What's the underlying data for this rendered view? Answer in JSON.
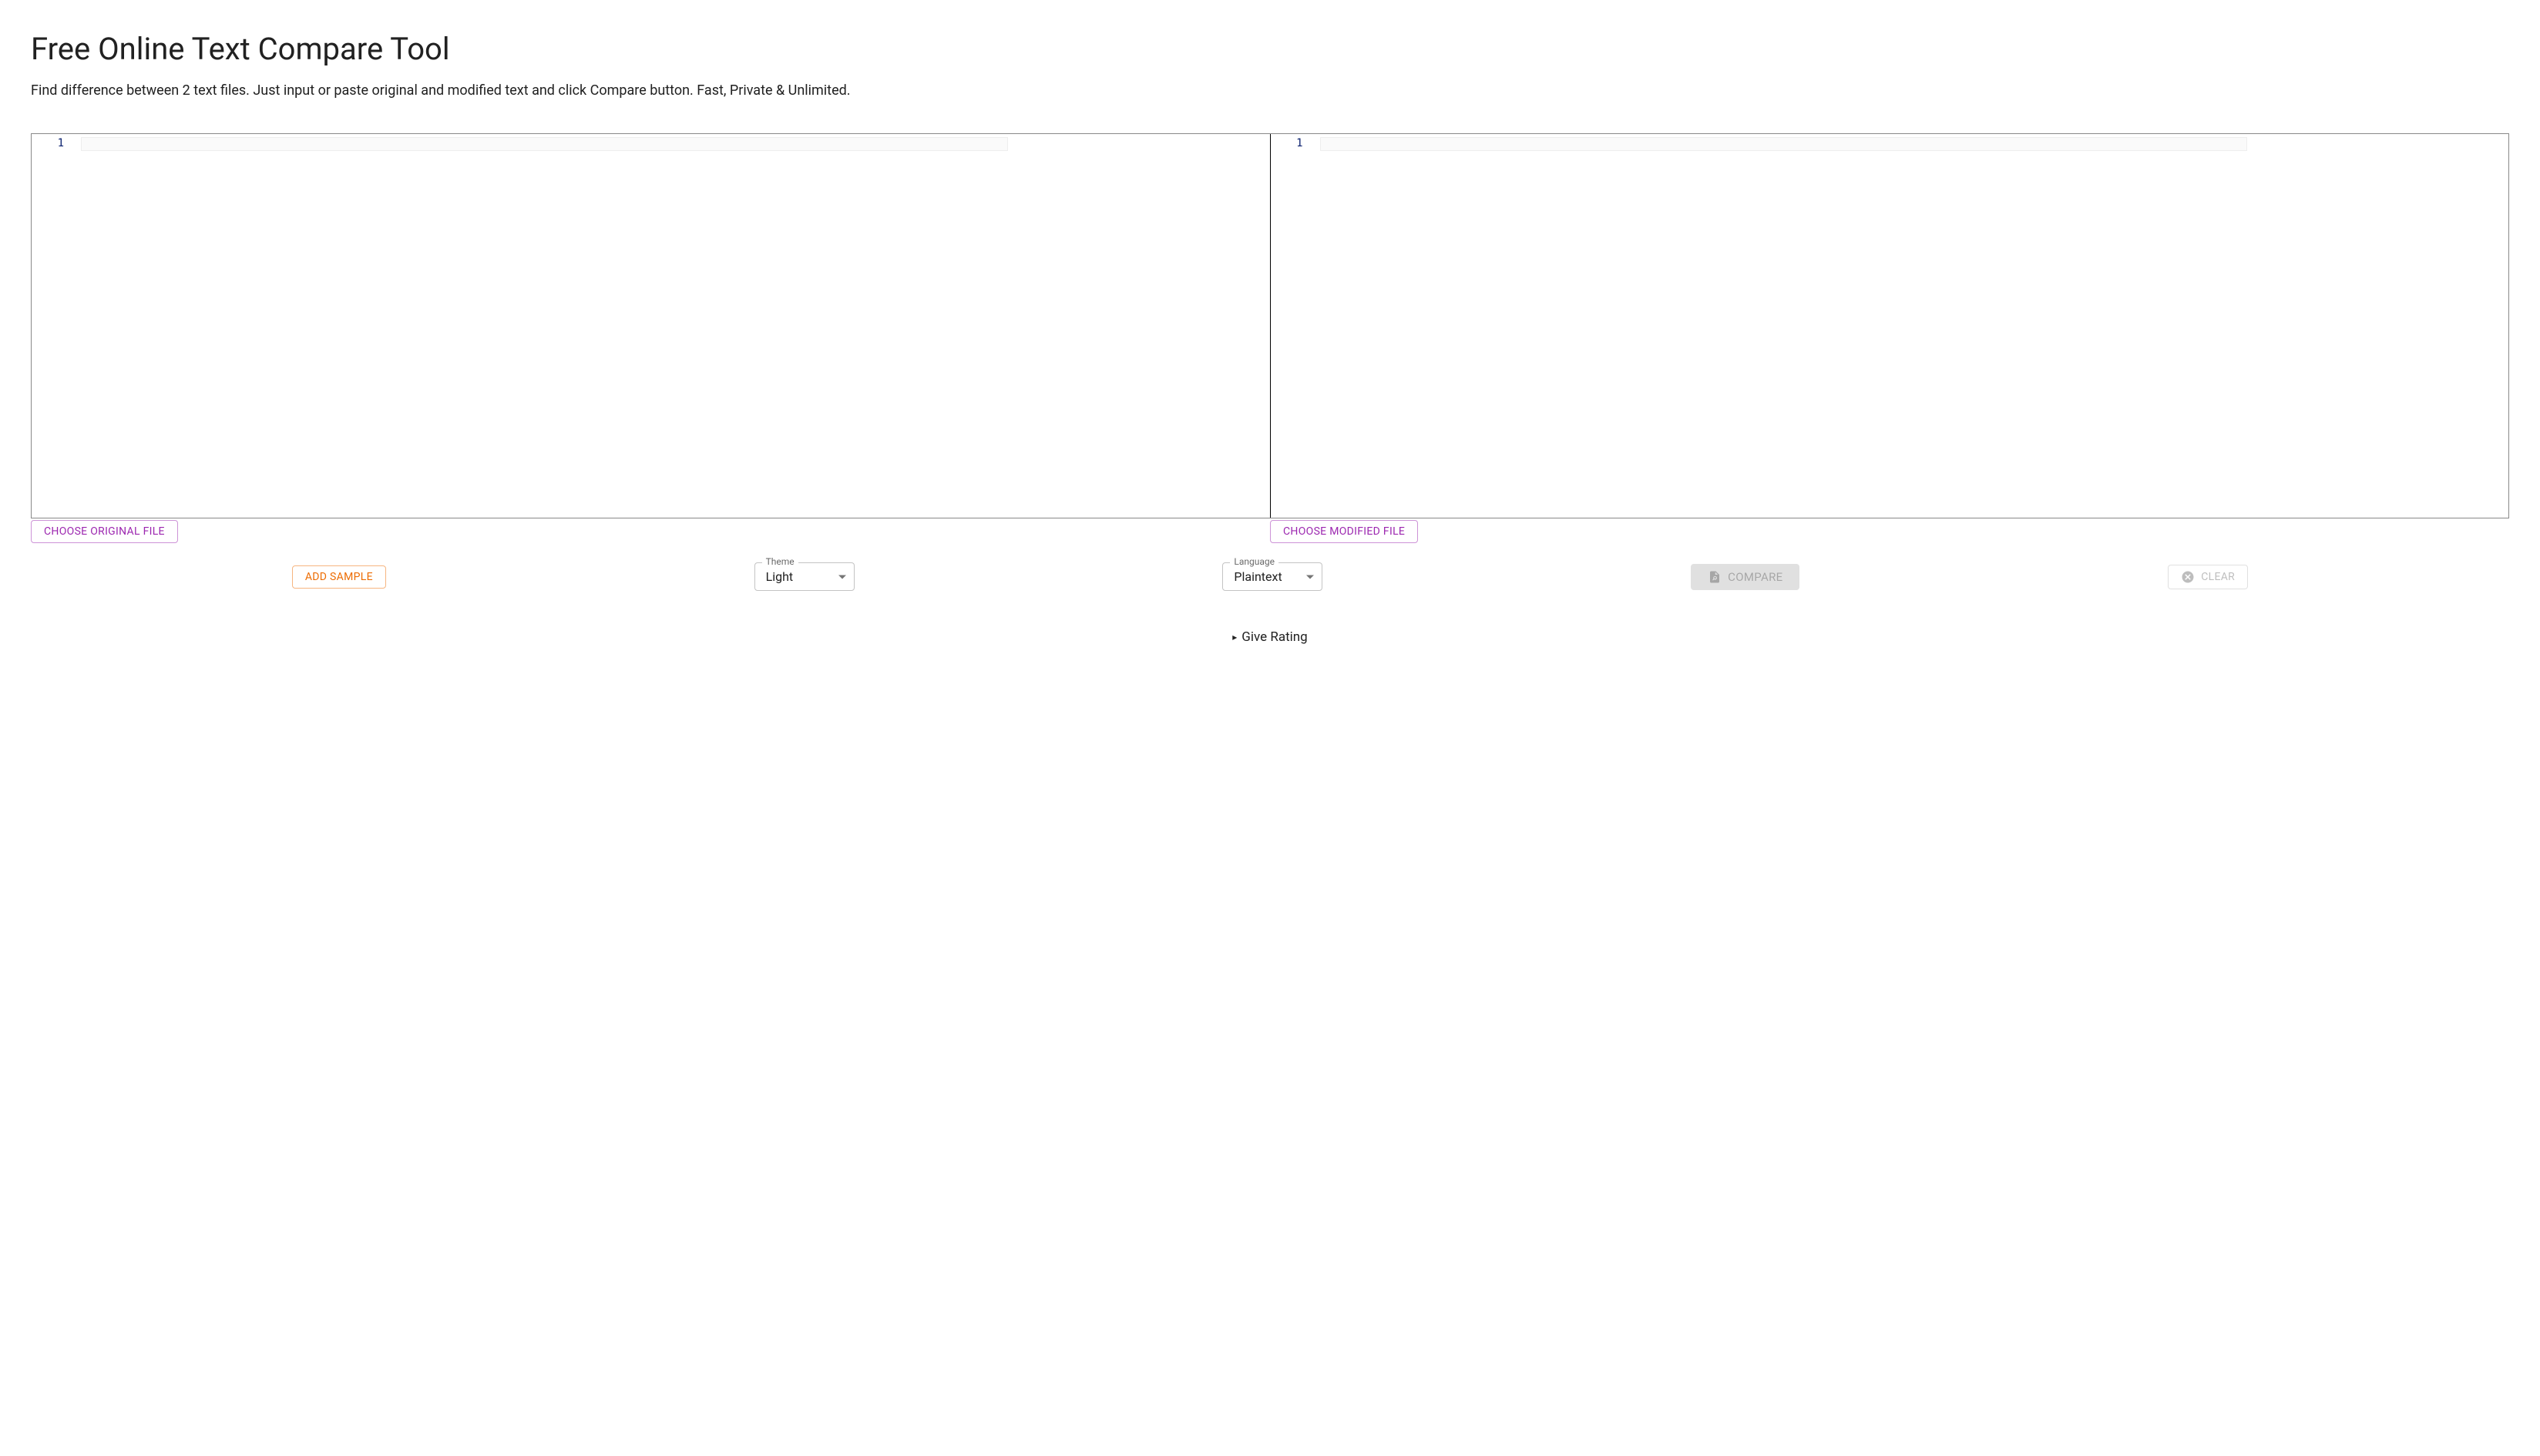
{
  "header": {
    "title": "Free Online Text Compare Tool",
    "description": "Find difference between 2 text files. Just input or paste original and modified text and click Compare button. Fast, Private & Unlimited."
  },
  "editors": {
    "left": {
      "line_number": "1"
    },
    "right": {
      "line_number": "1"
    }
  },
  "file_buttons": {
    "original": "CHOOSE ORIGINAL FILE",
    "modified": "CHOOSE MODIFIED FILE"
  },
  "toolbar": {
    "add_sample": "ADD SAMPLE",
    "theme": {
      "label": "Theme",
      "value": "Light"
    },
    "language": {
      "label": "Language",
      "value": "Plaintext"
    },
    "compare": "COMPARE",
    "clear": "CLEAR"
  },
  "rating": {
    "label": "Give Rating"
  }
}
